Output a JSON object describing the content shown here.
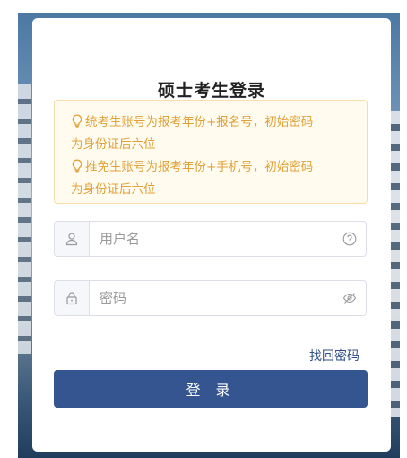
{
  "page": {
    "title": "硕士考生登录"
  },
  "notice": {
    "lines": [
      "统考生账号为报考年份+报名号，初始密码",
      "为身份证后六位",
      "推免生账号为报考年份+手机号，初始密码",
      "为身份证后六位"
    ],
    "icon": "lightbulb-icon"
  },
  "username": {
    "placeholder": "用户名",
    "value": "",
    "prefix_icon": "user-icon",
    "suffix_icon": "help-circle-icon"
  },
  "password": {
    "placeholder": "密码",
    "value": "",
    "prefix_icon": "lock-icon",
    "suffix_icon": "eye-off-icon"
  },
  "links": {
    "forgot_password": "找回密码"
  },
  "buttons": {
    "login_label": "登 录"
  },
  "colors": {
    "primary": "#34558f",
    "notice_text": "#e0a138",
    "notice_bg": "#fffbef",
    "link": "#2f4f86"
  }
}
